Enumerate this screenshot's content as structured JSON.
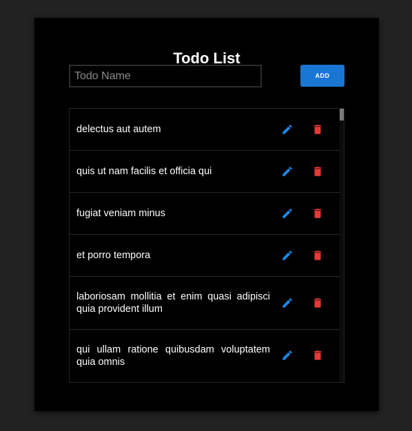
{
  "app": {
    "title": "Todo List"
  },
  "form": {
    "placeholder": "Todo Name",
    "add_label": "ADD"
  },
  "colors": {
    "accent": "#1976d2",
    "edit_icon": "#1e88e5",
    "delete_icon": "#e53935"
  },
  "todos": [
    {
      "text": "delectus aut autem",
      "edit_icon": "pencil-icon",
      "delete_icon": "trash-icon"
    },
    {
      "text": "quis ut nam facilis et officia qui",
      "edit_icon": "pencil-icon",
      "delete_icon": "trash-icon"
    },
    {
      "text": "fugiat veniam minus",
      "edit_icon": "pencil-icon",
      "delete_icon": "trash-icon"
    },
    {
      "text": "et porro tempora",
      "edit_icon": "pencil-icon",
      "delete_icon": "trash-icon"
    },
    {
      "text": "laboriosam mollitia et enim quasi adipisci quia provident illum",
      "edit_icon": "pencil-icon",
      "delete_icon": "trash-icon"
    },
    {
      "text": "qui ullam ratione quibusdam voluptatem quia omnis",
      "edit_icon": "pencil-icon",
      "delete_icon": "trash-icon"
    }
  ]
}
